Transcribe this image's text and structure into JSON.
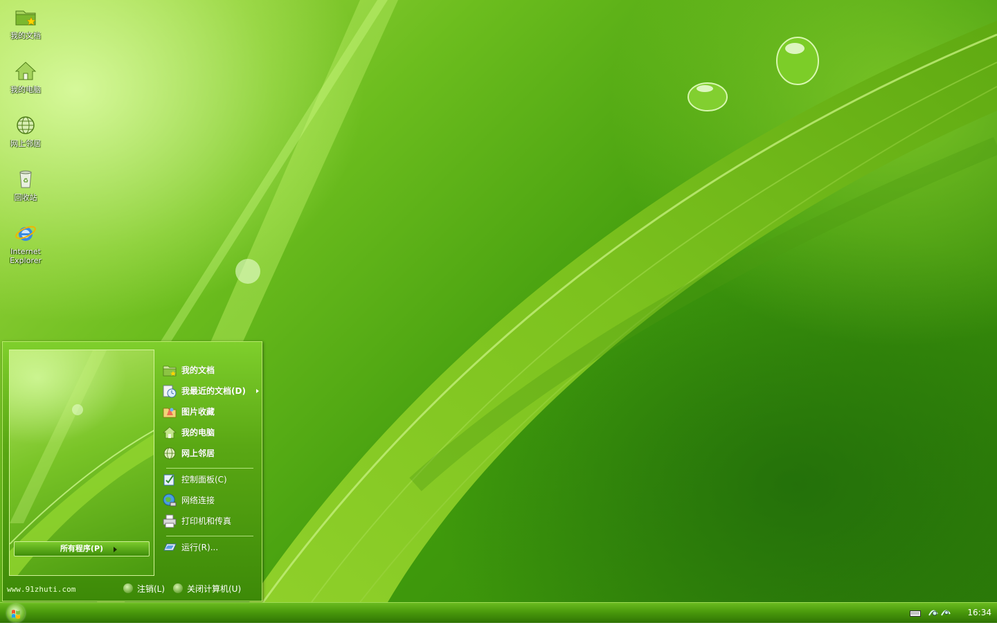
{
  "desktop_icons": [
    {
      "label": "我的文档",
      "icon": "my-documents-folder-icon"
    },
    {
      "label": "我的电脑",
      "icon": "my-computer-house-icon"
    },
    {
      "label": "网上邻居",
      "icon": "network-globe-icon"
    },
    {
      "label": "回收站",
      "icon": "recycle-bin-icon"
    },
    {
      "label": "Internet Explorer",
      "icon": "internet-explorer-icon"
    }
  ],
  "start_menu": {
    "all_programs": "所有程序(P)",
    "items": [
      {
        "label": "我的文档",
        "icon": "my-documents-folder-icon"
      },
      {
        "label": "我最近的文档(D)",
        "icon": "recent-documents-icon"
      },
      {
        "label": "图片收藏",
        "icon": "my-pictures-icon"
      },
      {
        "label": "我的电脑",
        "icon": "my-computer-house-icon"
      },
      {
        "label": "网上邻居",
        "icon": "network-globe-icon"
      },
      {
        "label": "控制面板(C)",
        "icon": "control-panel-icon"
      },
      {
        "label": "网络连接",
        "icon": "network-connections-icon"
      },
      {
        "label": "打印机和传真",
        "icon": "printer-icon"
      },
      {
        "label": "运行(R)...",
        "icon": "run-icon"
      }
    ],
    "site_url": "www.91zhuti.com",
    "logoff": "注销(L)",
    "shutdown": "关闭计算机(U)"
  },
  "taskbar": {
    "clock": "16:34",
    "tray_icons": [
      "keyboard-icon",
      "network-status-icon"
    ]
  },
  "colors": {
    "accent": "#5aa814",
    "taskbar": "#4a9a0c"
  }
}
